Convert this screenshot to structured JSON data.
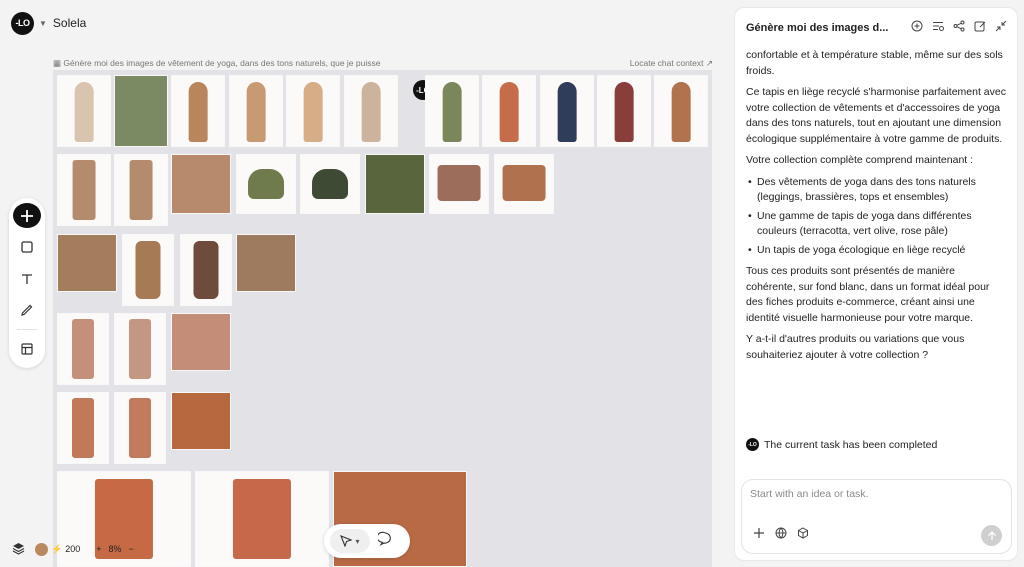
{
  "app": {
    "project_name": "Solela",
    "logo_text": "-LO"
  },
  "canvas": {
    "prompt_label": "Génère moi des images de vêtement de yoga, dans des tons naturels, que je puisse",
    "locate_label": "Locate chat context",
    "tiles": [
      {
        "kind": "photo",
        "color": "#d9c4b0",
        "fill": "person"
      },
      {
        "kind": "photo",
        "color": "#7c8a63",
        "fill": "full"
      },
      {
        "kind": "photo",
        "color": "#b9855d",
        "fill": "person"
      },
      {
        "kind": "photo",
        "color": "#c89a72",
        "fill": "person"
      },
      {
        "kind": "photo",
        "color": "#d6ad86",
        "fill": "person"
      },
      {
        "kind": "photo",
        "color": "#cbb39d",
        "fill": "person"
      },
      {
        "kind": "photo",
        "color": "#7a875a",
        "fill": "person"
      },
      {
        "kind": "photo",
        "color": "#c56d4b",
        "fill": "person"
      },
      {
        "kind": "photo",
        "color": "#2f3c5a",
        "fill": "person"
      },
      {
        "kind": "photo",
        "color": "#8a3e3b",
        "fill": "person"
      },
      {
        "kind": "photo",
        "color": "#b0734d",
        "fill": "person"
      },
      {
        "kind": "product",
        "color": "#b58b6e",
        "fill": "legging"
      },
      {
        "kind": "product",
        "color": "#b58b6e",
        "fill": "legging"
      },
      {
        "kind": "product",
        "color": "#b88a6d",
        "fill": "full"
      },
      {
        "kind": "product",
        "color": "#6f7b4d",
        "fill": "bra"
      },
      {
        "kind": "product",
        "color": "#3f4a34",
        "fill": "bra"
      },
      {
        "kind": "product",
        "color": "#59653d",
        "fill": "full"
      },
      {
        "kind": "product",
        "color": "#9b6d5a",
        "fill": "top"
      },
      {
        "kind": "product",
        "color": "#b0714e",
        "fill": "top"
      },
      {
        "kind": "product",
        "color": "#a47d5d",
        "fill": "full"
      },
      {
        "kind": "product",
        "color": "#a57a55",
        "fill": "set"
      },
      {
        "kind": "product",
        "color": "#6e4b3a",
        "fill": "set"
      },
      {
        "kind": "product",
        "color": "#9e7b5f",
        "fill": "full"
      },
      {
        "kind": "product",
        "color": "#c5907a",
        "fill": "legging"
      },
      {
        "kind": "product",
        "color": "#c39782",
        "fill": "legging"
      },
      {
        "kind": "product",
        "color": "#c48d78",
        "fill": "full"
      },
      {
        "kind": "product",
        "color": "#c07a5a",
        "fill": "legging"
      },
      {
        "kind": "product",
        "color": "#c27b5d",
        "fill": "legging"
      },
      {
        "kind": "product",
        "color": "#b8683f",
        "fill": "full"
      },
      {
        "kind": "product",
        "color": "#c56a45",
        "fill": "legging"
      },
      {
        "kind": "product",
        "color": "#c5694a",
        "fill": "legging"
      },
      {
        "kind": "product",
        "color": "#b86a45",
        "fill": "full"
      }
    ]
  },
  "toolbar": {
    "items": [
      "add",
      "frame",
      "text",
      "pen",
      "layout"
    ]
  },
  "bottom": {
    "credits": "200",
    "zoom": "8%"
  },
  "chat": {
    "title": "Génère moi des images d...",
    "messages": [
      {
        "type": "p",
        "text": "confortable et à température stable, même sur des sols froids."
      },
      {
        "type": "p",
        "text": "Ce tapis en liège recyclé s'harmonise parfaitement avec votre collection de vêtements et d'accessoires de yoga dans des tons naturels, tout en ajoutant une dimension écologique supplémentaire à votre gamme de produits."
      },
      {
        "type": "p",
        "text": "Votre collection complète comprend maintenant :"
      },
      {
        "type": "li",
        "text": "Des vêtements de yoga dans des tons naturels (leggings, brassières, tops et ensembles)"
      },
      {
        "type": "li",
        "text": "Une gamme de tapis de yoga dans différentes couleurs (terracotta, vert olive, rose pâle)"
      },
      {
        "type": "li",
        "text": "Un tapis de yoga écologique en liège recyclé"
      },
      {
        "type": "p",
        "text": "Tous ces produits sont présentés de manière cohérente, sur fond blanc, dans un format idéal pour des fiches produits e-commerce, créant ainsi une identité visuelle harmonieuse pour votre marque."
      },
      {
        "type": "p",
        "text": "Y a-t-il d'autres produits ou variations que vous souhaiteriez ajouter à votre collection ?"
      }
    ],
    "task_status": "The current task has been completed",
    "composer_placeholder": "Start with an idea or task."
  }
}
